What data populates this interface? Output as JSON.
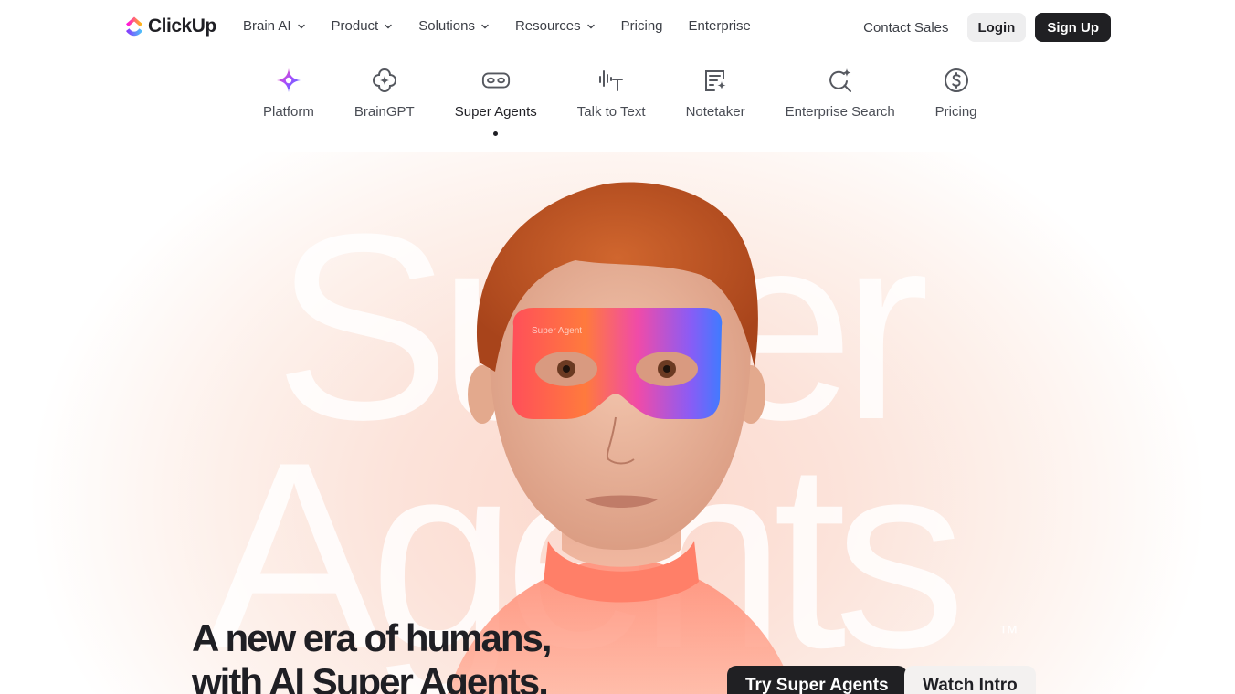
{
  "brand": {
    "name": "ClickUp"
  },
  "topnav": {
    "menu": [
      {
        "label": "Brain AI",
        "dropdown": true
      },
      {
        "label": "Product",
        "dropdown": true
      },
      {
        "label": "Solutions",
        "dropdown": true
      },
      {
        "label": "Resources",
        "dropdown": true
      },
      {
        "label": "Pricing",
        "dropdown": false
      },
      {
        "label": "Enterprise",
        "dropdown": false
      }
    ],
    "contact_label": "Contact Sales",
    "login_label": "Login",
    "signup_label": "Sign Up"
  },
  "subnav": {
    "items": [
      {
        "label": "Platform",
        "icon": "sparkle-icon"
      },
      {
        "label": "BrainGPT",
        "icon": "brain-flower-icon"
      },
      {
        "label": "Super Agents",
        "icon": "mask-icon",
        "active": true
      },
      {
        "label": "Talk to Text",
        "icon": "audio-text-icon"
      },
      {
        "label": "Notetaker",
        "icon": "note-sparkle-icon"
      },
      {
        "label": "Enterprise Search",
        "icon": "search-sparkle-icon"
      },
      {
        "label": "Pricing",
        "icon": "dollar-circle-icon"
      }
    ]
  },
  "hero": {
    "background_word_line1": "Super",
    "background_word_line2": "Agents",
    "trademark": "™",
    "mask_text": "Super Agent",
    "headline_line1": "A new era of humans,",
    "headline_line2": "with AI Super Agents.",
    "cta_primary": "Try Super Agents",
    "cta_secondary": "Watch Intro"
  },
  "colors": {
    "primary_dark": "#202023",
    "hero_peach": "#fbd8cc",
    "brand_purple": "#7b68ee",
    "brand_pink": "#fd71af",
    "brand_blue": "#49ccf9"
  }
}
